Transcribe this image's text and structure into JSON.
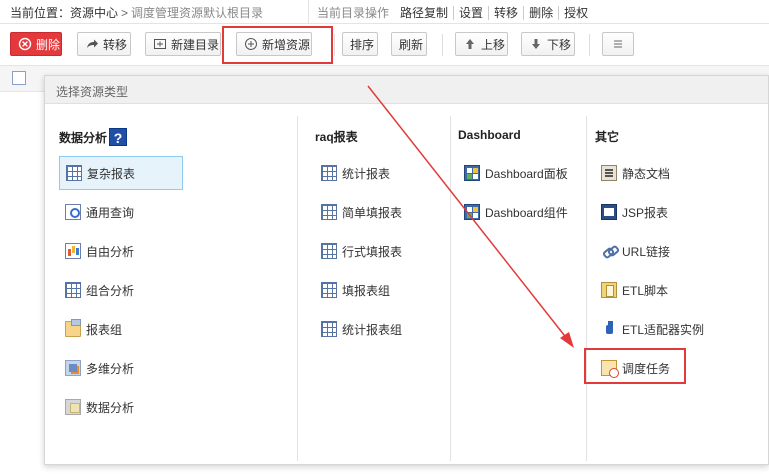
{
  "breadcrumb": {
    "label": "当前位置：",
    "root": "资源中心",
    "separator": ">",
    "current": "调度管理资源默认根目录"
  },
  "dir_ops": {
    "title": "当前目录操作",
    "items": [
      "路径复制",
      "设置",
      "转移",
      "删除",
      "授权"
    ]
  },
  "toolbar": {
    "delete": "删除",
    "move": "转移",
    "new_dir": "新建目录",
    "new_resource": "新增资源",
    "sort": "排序",
    "refresh": "刷新",
    "up": "上移",
    "down": "下移"
  },
  "panel": {
    "title": "选择资源类型",
    "columns": [
      {
        "title": "数据分析",
        "items": [
          "复杂报表",
          "通用查询",
          "自由分析",
          "组合分析",
          "报表组",
          "多维分析",
          "数据分析"
        ]
      },
      {
        "title": "raq报表",
        "items": [
          "统计报表",
          "简单填报表",
          "行式填报表",
          "填报表组",
          "统计报表组"
        ]
      },
      {
        "title": "Dashboard",
        "items": [
          "Dashboard面板",
          "Dashboard组件"
        ]
      },
      {
        "title": "其它",
        "items": [
          "静态文档",
          "JSP报表",
          "URL链接",
          "ETL脚本",
          "ETL适配器实例",
          "调度任务"
        ]
      }
    ]
  },
  "colors": {
    "delete_button": "#e4393c",
    "highlight": "#e23a3a",
    "selected_bg": "#e6f3fb"
  }
}
